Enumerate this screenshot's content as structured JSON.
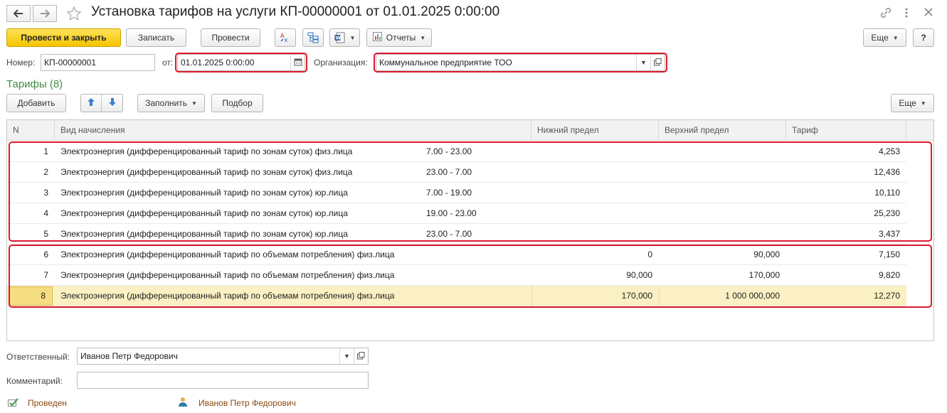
{
  "window": {
    "title": "Установка тарифов на услуги КП-00000001 от 01.01.2025 0:00:00"
  },
  "toolbar": {
    "post_close": "Провести и закрыть",
    "save": "Записать",
    "post": "Провести",
    "reports": "Отчеты",
    "more": "Еще",
    "help": "?"
  },
  "header": {
    "number_label": "Номер:",
    "number_value": "КП-00000001",
    "date_label": "от:",
    "date_value": "01.01.2025  0:00:00",
    "org_label": "Организация:",
    "org_value": "Коммунальное предприятие ТОО"
  },
  "tariffs": {
    "title": "Тарифы (8)",
    "add": "Добавить",
    "fill": "Заполнить",
    "pick": "Подбор",
    "more": "Еще",
    "columns": [
      "N",
      "Вид начисления",
      "Нижний предел",
      "Верхний предел",
      "Тариф"
    ],
    "rows": [
      {
        "n": "1",
        "kind": "Электроэнергия (дифференцированный тариф по зонам суток) физ.лица",
        "zone": "7.00 - 23.00",
        "lower": "",
        "upper": "",
        "tariff": "4,253"
      },
      {
        "n": "2",
        "kind": "Электроэнергия (дифференцированный тариф по зонам суток) физ.лица",
        "zone": "23.00 - 7.00",
        "lower": "",
        "upper": "",
        "tariff": "12,436"
      },
      {
        "n": "3",
        "kind": "Электроэнергия (дифференцированный тариф по зонам суток) юр.лица",
        "zone": "7.00 - 19.00",
        "lower": "",
        "upper": "",
        "tariff": "10,110"
      },
      {
        "n": "4",
        "kind": "Электроэнергия (дифференцированный тариф по зонам суток) юр.лица",
        "zone": "19.00 - 23.00",
        "lower": "",
        "upper": "",
        "tariff": "25,230"
      },
      {
        "n": "5",
        "kind": "Электроэнергия (дифференцированный тариф по зонам суток) юр.лица",
        "zone": "23.00 - 7.00",
        "lower": "",
        "upper": "",
        "tariff": "3,437"
      },
      {
        "n": "6",
        "kind": "Электроэнергия (дифференцированный тариф по объемам потребления) физ.лица",
        "zone": "",
        "lower": "0",
        "upper": "90,000",
        "tariff": "7,150"
      },
      {
        "n": "7",
        "kind": "Электроэнергия (дифференцированный тариф по объемам потребления) физ.лица",
        "zone": "",
        "lower": "90,000",
        "upper": "170,000",
        "tariff": "9,820"
      },
      {
        "n": "8",
        "kind": "Электроэнергия (дифференцированный тариф по объемам потребления) физ.лица",
        "zone": "",
        "lower": "170,000",
        "upper": "1 000 000,000",
        "tariff": "12,270"
      }
    ]
  },
  "footer": {
    "responsible_label": "Ответственный:",
    "responsible_value": "Иванов Петр Федорович",
    "comment_label": "Комментарий:",
    "comment_value": "",
    "status_text": "Проведен",
    "author_text": "Иванов Петр Федорович"
  },
  "colors": {
    "accent": "#f5c400",
    "highlight": "#e0182d",
    "section": "#3d8f3d",
    "selected_row": "#fbf0c4",
    "status_text": "#8a4a12"
  },
  "icons": [
    "back-arrow-icon",
    "forward-arrow-icon",
    "star-icon",
    "link-icon",
    "kebab-menu-icon",
    "close-icon",
    "spelling-icon",
    "structure-icon",
    "word-icon",
    "reports-icon",
    "calendar-icon",
    "open-icon",
    "arrow-up-icon",
    "arrow-down-icon",
    "posted-icon",
    "user-icon"
  ]
}
